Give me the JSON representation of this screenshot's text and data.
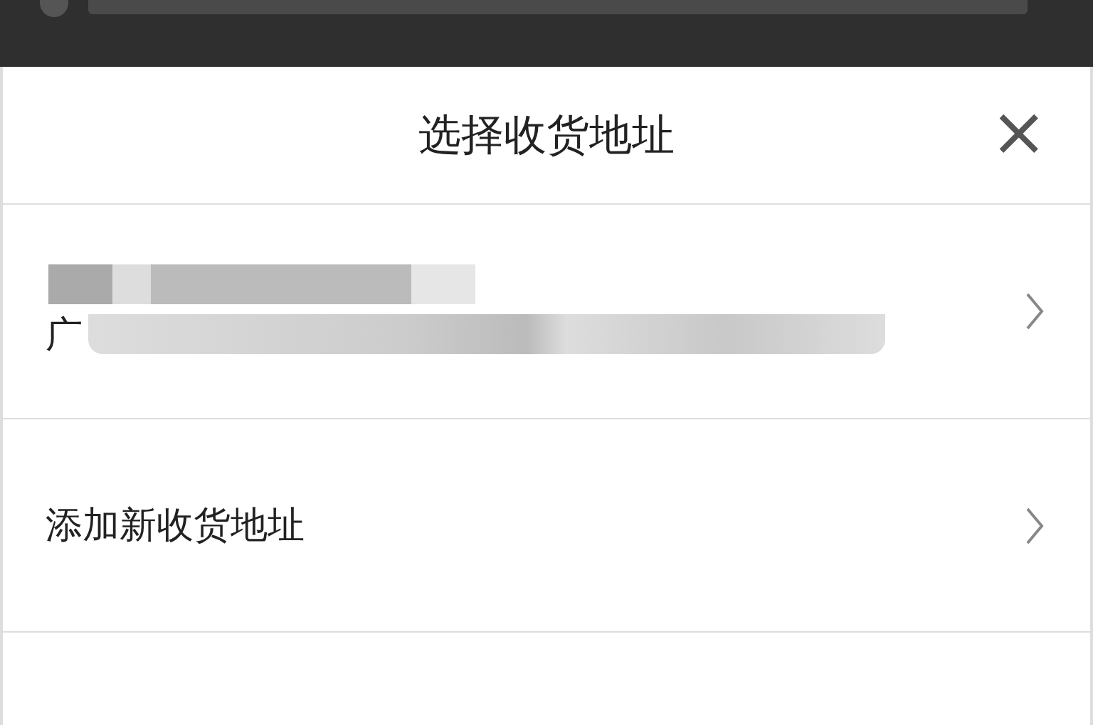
{
  "sheet": {
    "title": "选择收货地址",
    "close": "×"
  },
  "address": {
    "line_2_prefix": "广"
  },
  "add_address": {
    "label": "添加新收货地址"
  }
}
